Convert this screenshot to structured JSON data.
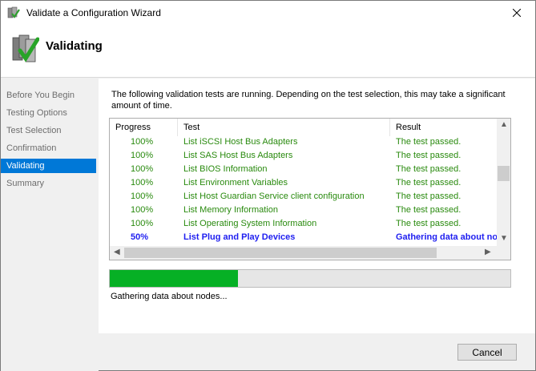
{
  "window": {
    "title": "Validate a Configuration Wizard"
  },
  "header": {
    "title": "Validating"
  },
  "nav": {
    "items": [
      {
        "label": "Before You Begin",
        "active": false
      },
      {
        "label": "Testing Options",
        "active": false
      },
      {
        "label": "Test Selection",
        "active": false
      },
      {
        "label": "Confirmation",
        "active": false
      },
      {
        "label": "Validating",
        "active": true
      },
      {
        "label": "Summary",
        "active": false
      }
    ]
  },
  "content": {
    "description": "The following validation tests are running. Depending on the test selection, this may take a significant amount of time.",
    "columns": {
      "progress": "Progress",
      "test": "Test",
      "result": "Result"
    },
    "rows": [
      {
        "progress": "100%",
        "test": "List iSCSI Host Bus Adapters",
        "result": "The test passed.",
        "current": false
      },
      {
        "progress": "100%",
        "test": "List SAS Host Bus Adapters",
        "result": "The test passed.",
        "current": false
      },
      {
        "progress": "100%",
        "test": "List BIOS Information",
        "result": "The test passed.",
        "current": false
      },
      {
        "progress": "100%",
        "test": "List Environment Variables",
        "result": "The test passed.",
        "current": false
      },
      {
        "progress": "100%",
        "test": "List Host Guardian Service client configuration",
        "result": "The test passed.",
        "current": false
      },
      {
        "progress": "100%",
        "test": "List Memory Information",
        "result": "The test passed.",
        "current": false
      },
      {
        "progress": "100%",
        "test": "List Operating System Information",
        "result": "The test passed.",
        "current": false
      },
      {
        "progress": "50%",
        "test": "List Plug and Play Devices",
        "result": "Gathering data about nodes...",
        "current": true
      }
    ],
    "overall_progress": 0.32,
    "status": "Gathering data about nodes..."
  },
  "footer": {
    "cancel_label": "Cancel"
  },
  "colors": {
    "passed": "#298a0e",
    "current": "#1e1ef0",
    "accent": "#0078d7",
    "progress_fill": "#06b025"
  }
}
